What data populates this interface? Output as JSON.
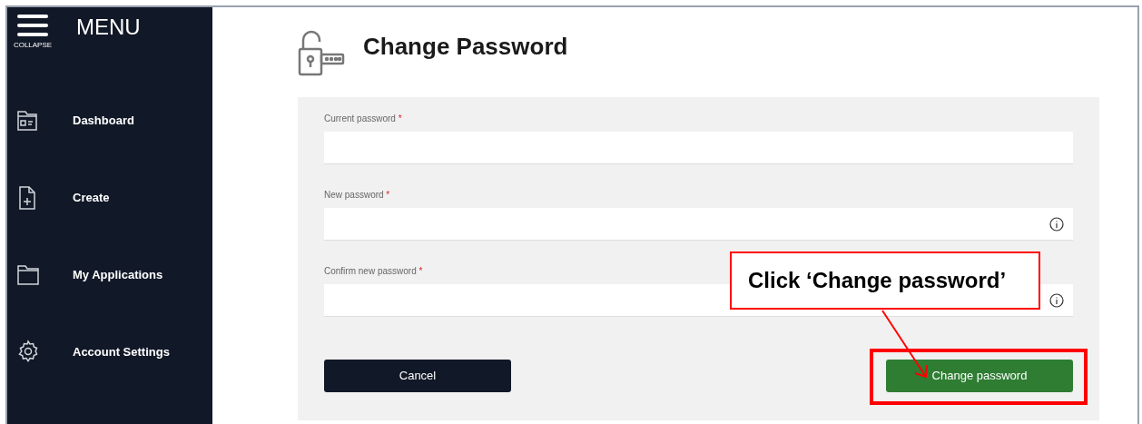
{
  "sidebar": {
    "collapse_label": "COLLAPSE",
    "menu_title": "MENU",
    "items": [
      {
        "kind": "dashboard",
        "label": "Dashboard"
      },
      {
        "kind": "create",
        "label": "Create"
      },
      {
        "kind": "applications",
        "label": "My Applications"
      },
      {
        "kind": "settings",
        "label": "Account Settings"
      }
    ]
  },
  "page": {
    "title": "Change Password"
  },
  "form": {
    "fields": [
      {
        "label": "Current password",
        "required_mark": "*",
        "info": false
      },
      {
        "label": "New password",
        "required_mark": "*",
        "info": true
      },
      {
        "label": "Confirm new password",
        "required_mark": "*",
        "info": true
      }
    ],
    "buttons": [
      {
        "kind": "secondary",
        "label": "Cancel"
      },
      {
        "kind": "primary",
        "label": "Change password"
      }
    ]
  },
  "callout": {
    "text": "Click ‘Change password’"
  }
}
